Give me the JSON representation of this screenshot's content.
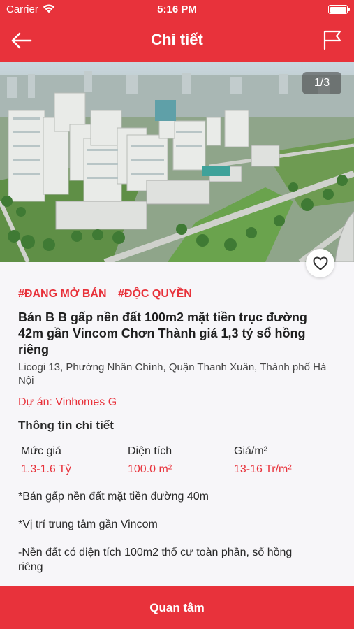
{
  "status_bar": {
    "carrier": "Carrier",
    "time": "5:16 PM"
  },
  "nav": {
    "title": "Chi tiết",
    "back_icon": "arrow-left-icon",
    "flag_icon": "flag-icon"
  },
  "photo": {
    "counter": "1/3",
    "favorite_icon": "heart-icon"
  },
  "listing": {
    "tags": [
      "#ĐANG MỞ BÁN",
      "#ĐỘC QUYỀN"
    ],
    "title": "Bán B B gấp nền đất 100m2 mặt tiền trục đường 42m gần Vincom Chơn Thành giá 1,3 tỷ sổ hồng riêng",
    "address": "Licogi 13, Phường Nhân Chính, Quận Thanh Xuân, Thành phố Hà Nội",
    "project": "Dự án: Vinhomes G"
  },
  "details": {
    "section_title": "Thông tin chi tiết",
    "specs": [
      {
        "label": "Mức giá",
        "value": "1.3-1.6 Tỷ"
      },
      {
        "label": "Diện tích",
        "value": "100.0 m²"
      },
      {
        "label": "Giá/m²",
        "value": "13-16 Tr/m²"
      }
    ],
    "description": [
      "*Bán gấp nền đất mặt tiền đường 40m",
      "*Vị trí trung tâm gần Vincom",
      "-Nền đất có diện tích 100m2 thổ cư toàn phần, sổ hồng riêng"
    ]
  },
  "action": {
    "label": "Quan tâm"
  },
  "colors": {
    "brand": "#e8323b",
    "background": "#f7f6f9"
  }
}
